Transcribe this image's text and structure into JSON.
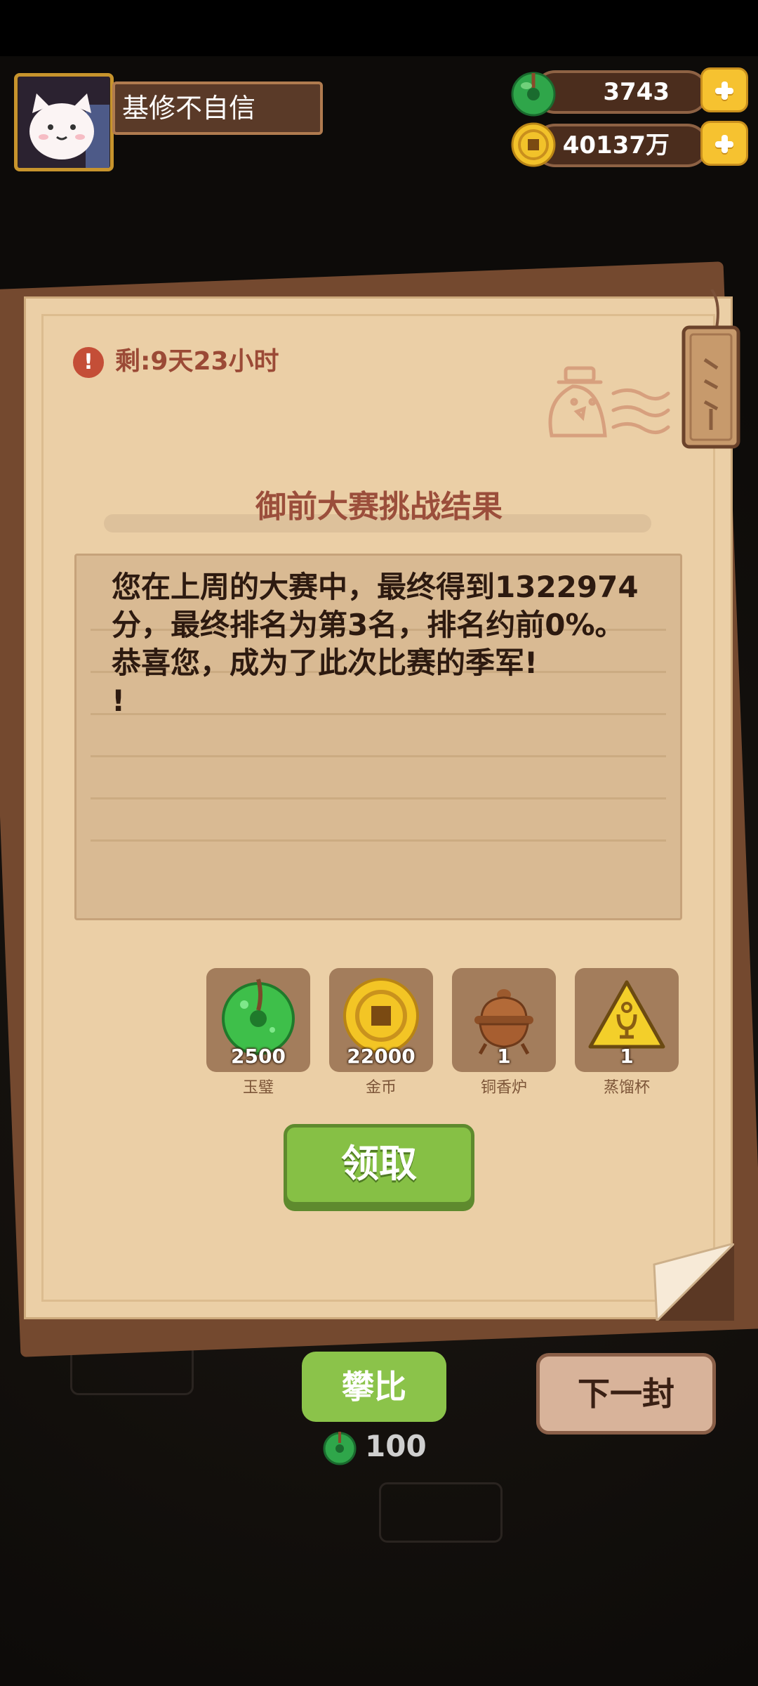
{
  "player": {
    "name": "基修不自信"
  },
  "currency": {
    "jade": "3743",
    "gold": "40137万"
  },
  "letter": {
    "timer": "剩:9天23小时",
    "title": "御前大赛挑战结果",
    "message": "您在上周的大赛中，最终得到1322974分，最终排名为第3名，排名约前0%。\n恭喜您，成为了此次比赛的季军!\n!"
  },
  "rewards": [
    {
      "count": "2500",
      "label": "玉璧",
      "icon": "jade-disc-icon"
    },
    {
      "count": "22000",
      "label": "金币",
      "icon": "gold-coin-icon"
    },
    {
      "count": "1",
      "label": "铜香炉",
      "icon": "copper-censer-icon"
    },
    {
      "count": "1",
      "label": "蒸馏杯",
      "icon": "distill-cup-icon"
    }
  ],
  "buttons": {
    "claim": "领取",
    "compare": "攀比",
    "compare_cost": "100",
    "next": "下一封"
  },
  "colors": {
    "paper": "#ebcfa6",
    "claim_green": "#86c045",
    "title_brown": "#9b4e3b",
    "gold": "#f6c230"
  }
}
